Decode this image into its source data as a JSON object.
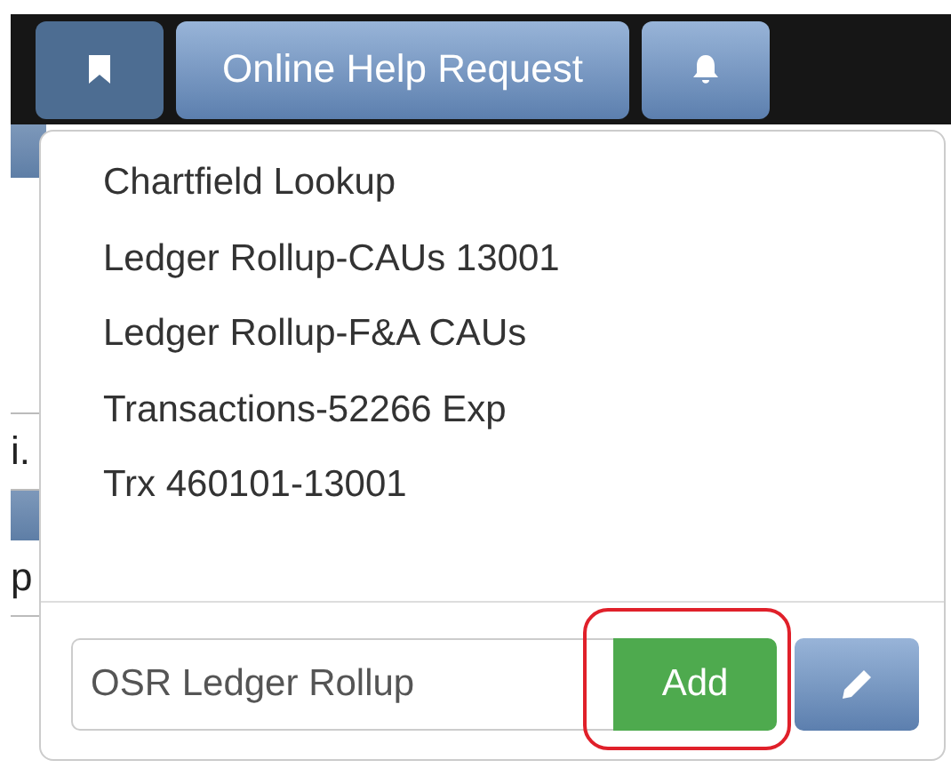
{
  "toolbar": {
    "buttons": [
      {
        "kind": "bookmark",
        "selected": true
      },
      {
        "kind": "text",
        "label": "Online Help Request",
        "selected": false
      },
      {
        "kind": "bell",
        "selected": false
      }
    ]
  },
  "background_fragments": [
    "i.",
    "p"
  ],
  "bookmarks_menu": {
    "items": [
      "Chartfield Lookup",
      "Ledger Rollup-CAUs 13001",
      "Ledger Rollup-F&A CAUs",
      "Transactions-52266 Exp",
      "Trx 460101-13001"
    ],
    "name_field": {
      "value": "OSR Ledger Rollup"
    },
    "add_button": {
      "label": "Add",
      "highlighted": true
    }
  }
}
